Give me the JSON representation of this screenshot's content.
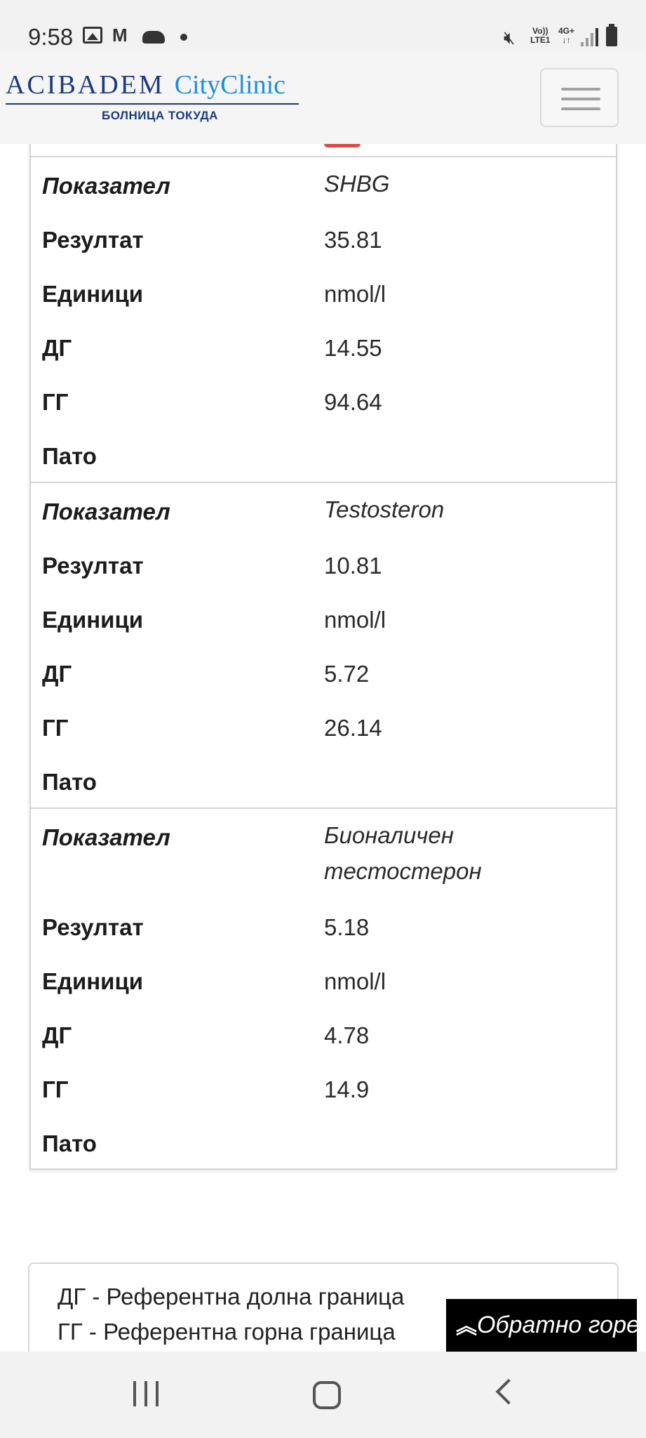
{
  "status_bar": {
    "time": "9:58",
    "icons": [
      "gallery-icon",
      "gmail-icon",
      "cloud-icon",
      "dot-icon",
      "mute-icon",
      "volte-icon",
      "4g-icon",
      "signal-icon",
      "battery-icon"
    ],
    "volte_top": "Vo))",
    "volte_bottom": "LTE1",
    "network_top": "4G+",
    "network_bottom": "↓↑"
  },
  "header": {
    "logo_main": "ACIBADEM",
    "logo_city": "CityClinic",
    "logo_sub": "БОЛНИЦА ТОКУДА"
  },
  "results": [
    {
      "rows": [
        {
          "label": "Показател",
          "value": "SHBG"
        },
        {
          "label": "Резултат",
          "value": "35.81"
        },
        {
          "label": "Единици",
          "value": "nmol/l"
        },
        {
          "label": "ДГ",
          "value": "14.55"
        },
        {
          "label": "ГГ",
          "value": "94.64"
        },
        {
          "label": "Пато",
          "value": ""
        }
      ]
    },
    {
      "rows": [
        {
          "label": "Показател",
          "value": "Testosteron"
        },
        {
          "label": "Резултат",
          "value": "10.81"
        },
        {
          "label": "Единици",
          "value": "nmol/l"
        },
        {
          "label": "ДГ",
          "value": "5.72"
        },
        {
          "label": "ГГ",
          "value": "26.14"
        },
        {
          "label": "Пато",
          "value": ""
        }
      ]
    },
    {
      "rows": [
        {
          "label": "Показател",
          "value": "Бионаличен тестостерон"
        },
        {
          "label": "Резултат",
          "value": "5.18"
        },
        {
          "label": "Единици",
          "value": "nmol/l"
        },
        {
          "label": "ДГ",
          "value": "4.78"
        },
        {
          "label": "ГГ",
          "value": "14.9"
        },
        {
          "label": "Пато",
          "value": ""
        }
      ]
    }
  ],
  "legend": {
    "line1": "ДГ - Референтна долна граница",
    "line2": "ГГ - Референтна горна граница"
  },
  "back_to_top": {
    "icon": "double-chevron-up-icon",
    "label": "Обратно горе"
  },
  "nav_bar": {
    "icons": [
      "recent-apps-icon",
      "home-icon",
      "back-icon"
    ]
  }
}
